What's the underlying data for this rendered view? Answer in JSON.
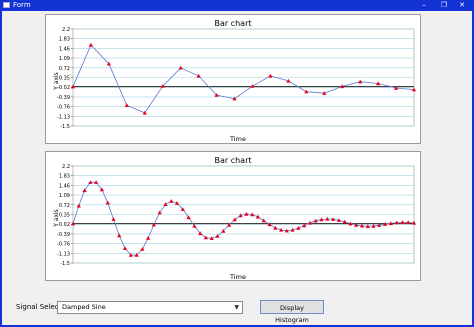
{
  "window": {
    "title": "Form",
    "controls": [
      "–",
      "❐",
      "✕"
    ]
  },
  "charts": [
    {
      "title": "Bar chart",
      "xlabel": "Time",
      "ylabel": "Y axis",
      "yticks": [
        "2.2",
        "1.83",
        "1.46",
        "1.09",
        "0.72",
        "0.35",
        "-0.02",
        "-0.39",
        "-0.76",
        "-1.13",
        "-1.5"
      ],
      "marker_color": "#e8001a",
      "line_color": "#5a78d8"
    },
    {
      "title": "Bar chart",
      "xlabel": "Time",
      "ylabel": "Y axis",
      "yticks": [
        "2.2",
        "1.83",
        "1.46",
        "1.09",
        "0.72",
        "0.35",
        "-0.02",
        "-0.39",
        "-0.76",
        "-1.13",
        "-1.5"
      ],
      "marker_color": "#e8001a",
      "line_color": "#5a78d8"
    }
  ],
  "chart_data": [
    {
      "type": "line",
      "title": "Bar chart",
      "xlabel": "Time",
      "ylabel": "Y axis",
      "ylim": [
        -1.5,
        2.2
      ],
      "x": [
        0,
        1,
        2,
        3,
        4,
        5,
        6,
        7,
        8,
        9,
        10,
        11,
        12,
        13,
        14,
        15,
        16,
        17,
        18,
        19
      ],
      "values": [
        0.0,
        1.59,
        0.87,
        -0.71,
        -1.0,
        0.02,
        0.72,
        0.41,
        -0.32,
        -0.46,
        0.02,
        0.41,
        0.22,
        -0.19,
        -0.25,
        0.01,
        0.19,
        0.12,
        -0.05,
        -0.11
      ],
      "grid": true,
      "zero_line": true
    },
    {
      "type": "line",
      "title": "Bar chart",
      "xlabel": "Time",
      "ylabel": "Y axis",
      "ylim": [
        -1.5,
        2.2
      ],
      "x_count": 60,
      "values": [
        0.0,
        0.68,
        1.27,
        1.58,
        1.58,
        1.3,
        0.8,
        0.17,
        -0.45,
        -0.94,
        -1.2,
        -1.2,
        -0.97,
        -0.55,
        -0.04,
        0.42,
        0.74,
        0.86,
        0.78,
        0.55,
        0.24,
        -0.09,
        -0.37,
        -0.53,
        -0.56,
        -0.47,
        -0.28,
        -0.05,
        0.16,
        0.31,
        0.37,
        0.35,
        0.26,
        0.12,
        -0.03,
        -0.16,
        -0.24,
        -0.27,
        -0.24,
        -0.17,
        -0.07,
        0.03,
        0.11,
        0.16,
        0.18,
        0.17,
        0.13,
        0.07,
        0.0,
        -0.05,
        -0.08,
        -0.1,
        -0.09,
        -0.06,
        -0.02,
        0.01,
        0.04,
        0.05,
        0.05,
        0.03
      ],
      "grid": true,
      "zero_line": true
    }
  ],
  "controls": {
    "signal_label": "Signal Select",
    "signal_value": "Damped Sine",
    "button_label": "Display Histogram"
  }
}
